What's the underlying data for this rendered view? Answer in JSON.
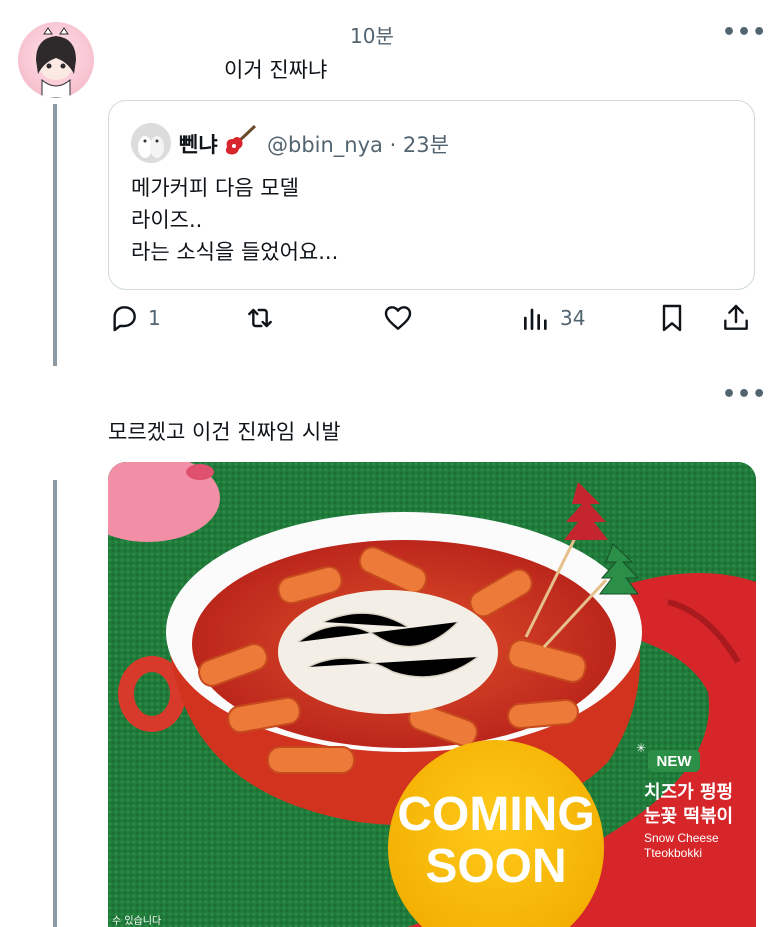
{
  "tweet1": {
    "time": "10분",
    "text": "이거 진짜냐",
    "more_label": "•••"
  },
  "quote": {
    "name": "뻰냐",
    "handle_time": "@bbin_nya · 23분",
    "lines": [
      "메가커피 다음 모델",
      "라이즈..",
      "라는 소식을 들었어요..."
    ]
  },
  "actions": {
    "reply_count": "1",
    "views_count": "34"
  },
  "tweet2": {
    "text": "모르겠고 이건 진짜임 시발",
    "more_label": "•••"
  },
  "photo": {
    "badge_new": "NEW",
    "product_ko_line1": "치즈가 펑펑",
    "product_ko_line2": "눈꽃 떡볶이",
    "product_en_line1": "Snow Cheese",
    "product_en_line2": "Tteokbokki",
    "coming_line1": "COMING",
    "coming_line2": "SOON",
    "footnote": "수 있습니다"
  },
  "colors": {
    "secondary_text": "#536471",
    "border": "#cfd9de",
    "coming_soon_yellow": "#f5b800",
    "sauce_red": "#d4301e",
    "felt_green": "#1f7a3a"
  }
}
